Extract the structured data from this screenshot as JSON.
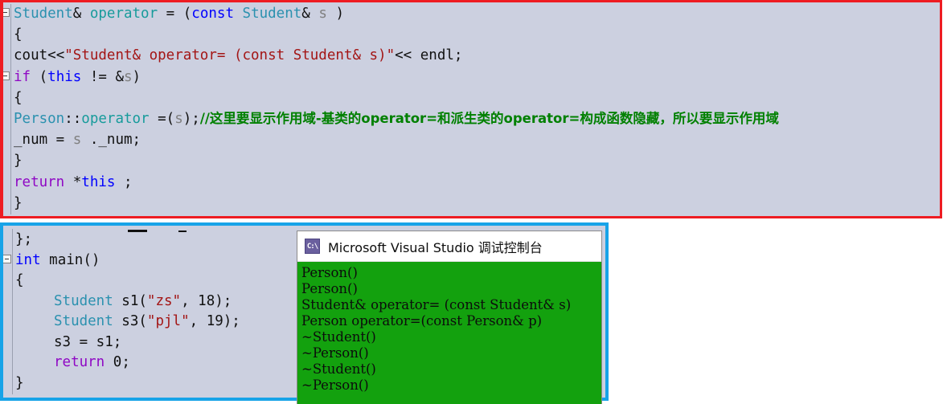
{
  "editor": {
    "background_color": "#ccd0e0",
    "annotation_boxes": {
      "top_box_color": "#ee1c22",
      "bottom_box_color": "#17a3e8"
    },
    "top_panel_lines": [
      {
        "indent": 0,
        "fold": true,
        "tokens": [
          {
            "t": "Student",
            "c": "t-type"
          },
          {
            "t": "& ",
            "c": "t-plain"
          },
          {
            "t": "operator",
            "c": "t-func"
          },
          {
            "t": " = (",
            "c": "t-plain"
          },
          {
            "t": "const",
            "c": "t-kw"
          },
          {
            "t": " ",
            "c": "t-plain"
          },
          {
            "t": "Student",
            "c": "t-type"
          },
          {
            "t": "& ",
            "c": "t-plain"
          },
          {
            "t": "s",
            "c": "t-var"
          },
          {
            "t": " )",
            "c": "t-plain"
          }
        ]
      },
      {
        "indent": 0,
        "fold": false,
        "tokens": [
          {
            "t": "{",
            "c": "t-plain"
          }
        ]
      },
      {
        "indent": 0,
        "fold": false,
        "tokens": [
          {
            "t": "cout",
            "c": "t-plain"
          },
          {
            "t": "<<",
            "c": "t-plain"
          },
          {
            "t": "\"Student& operator= (const Student& s)\"",
            "c": "t-str"
          },
          {
            "t": "<< ",
            "c": "t-plain"
          },
          {
            "t": "endl",
            "c": "t-plain"
          },
          {
            "t": ";",
            "c": "t-plain"
          }
        ]
      },
      {
        "indent": 0,
        "fold": true,
        "tokens": [
          {
            "t": "if",
            "c": "t-kw2"
          },
          {
            "t": " (",
            "c": "t-plain"
          },
          {
            "t": "this",
            "c": "t-kw"
          },
          {
            "t": " != &",
            "c": "t-plain"
          },
          {
            "t": "s",
            "c": "t-var"
          },
          {
            "t": ")",
            "c": "t-plain"
          }
        ]
      },
      {
        "indent": 0,
        "fold": false,
        "tokens": [
          {
            "t": "{",
            "c": "t-plain"
          }
        ]
      },
      {
        "indent": 0,
        "fold": false,
        "tokens": [
          {
            "t": "Person",
            "c": "t-type"
          },
          {
            "t": "::",
            "c": "t-plain"
          },
          {
            "t": "operator",
            "c": "t-func"
          },
          {
            "t": " =(",
            "c": "t-plain"
          },
          {
            "t": "s",
            "c": "t-var"
          },
          {
            "t": ");",
            "c": "t-plain"
          },
          {
            "t": "//这里要显示作用域-基类的operator=和派生类的operator=构成函数隐藏，所以要显示作用域",
            "c": "t-comment cjk"
          }
        ]
      },
      {
        "indent": 0,
        "fold": false,
        "tokens": [
          {
            "t": "_num = ",
            "c": "t-plain"
          },
          {
            "t": "s",
            "c": "t-var"
          },
          {
            "t": " ._num;",
            "c": "t-plain"
          }
        ]
      },
      {
        "indent": 0,
        "fold": false,
        "tokens": [
          {
            "t": "}",
            "c": "t-plain"
          }
        ]
      },
      {
        "indent": 0,
        "fold": false,
        "tokens": [
          {
            "t": "return",
            "c": "t-kw2"
          },
          {
            "t": " *",
            "c": "t-plain"
          },
          {
            "t": "this",
            "c": "t-kw"
          },
          {
            "t": " ;",
            "c": "t-plain"
          }
        ]
      },
      {
        "indent": 0,
        "fold": false,
        "tokens": [
          {
            "t": "}",
            "c": "t-plain"
          }
        ]
      }
    ],
    "bottom_panel_lines": [
      {
        "indent": 0,
        "fold": false,
        "tokens": [
          {
            "t": "};",
            "c": "t-plain"
          }
        ]
      },
      {
        "indent": 0,
        "fold": true,
        "tokens": [
          {
            "t": "int",
            "c": "t-kw"
          },
          {
            "t": " ",
            "c": "t-plain"
          },
          {
            "t": "main",
            "c": "t-plain"
          },
          {
            "t": "()",
            "c": "t-plain"
          }
        ]
      },
      {
        "indent": 0,
        "fold": false,
        "tokens": [
          {
            "t": "{",
            "c": "t-plain"
          }
        ]
      },
      {
        "indent": 1,
        "fold": false,
        "tokens": [
          {
            "t": "Student",
            "c": "t-type"
          },
          {
            "t": " s1(",
            "c": "t-plain"
          },
          {
            "t": "\"zs\"",
            "c": "t-str"
          },
          {
            "t": ", ",
            "c": "t-plain"
          },
          {
            "t": "18",
            "c": "t-num"
          },
          {
            "t": ");",
            "c": "t-plain"
          }
        ]
      },
      {
        "indent": 1,
        "fold": false,
        "tokens": [
          {
            "t": "Student",
            "c": "t-type"
          },
          {
            "t": " s3(",
            "c": "t-plain"
          },
          {
            "t": "\"pjl\"",
            "c": "t-str"
          },
          {
            "t": ", ",
            "c": "t-plain"
          },
          {
            "t": "19",
            "c": "t-num"
          },
          {
            "t": ");",
            "c": "t-plain"
          }
        ]
      },
      {
        "indent": 1,
        "fold": false,
        "tokens": [
          {
            "t": "s3 = s1;",
            "c": "t-plain"
          }
        ]
      },
      {
        "indent": 1,
        "fold": false,
        "tokens": [
          {
            "t": "return",
            "c": "t-kw2"
          },
          {
            "t": " ",
            "c": "t-plain"
          },
          {
            "t": "0",
            "c": "t-num"
          },
          {
            "t": ";",
            "c": "t-plain"
          }
        ]
      },
      {
        "indent": 0,
        "fold": false,
        "tokens": [
          {
            "t": "}",
            "c": "t-plain"
          }
        ]
      }
    ]
  },
  "console": {
    "icon_label": "C:\\",
    "title": "Microsoft Visual Studio 调试控制台",
    "background_color": "#13a10e",
    "output_lines": [
      "Person()",
      "Person()",
      "Student& operator= (const Student& s)",
      "Person operator=(const Person& p)",
      "~Student()",
      "~Person()",
      "~Student()",
      "~Person()"
    ]
  }
}
